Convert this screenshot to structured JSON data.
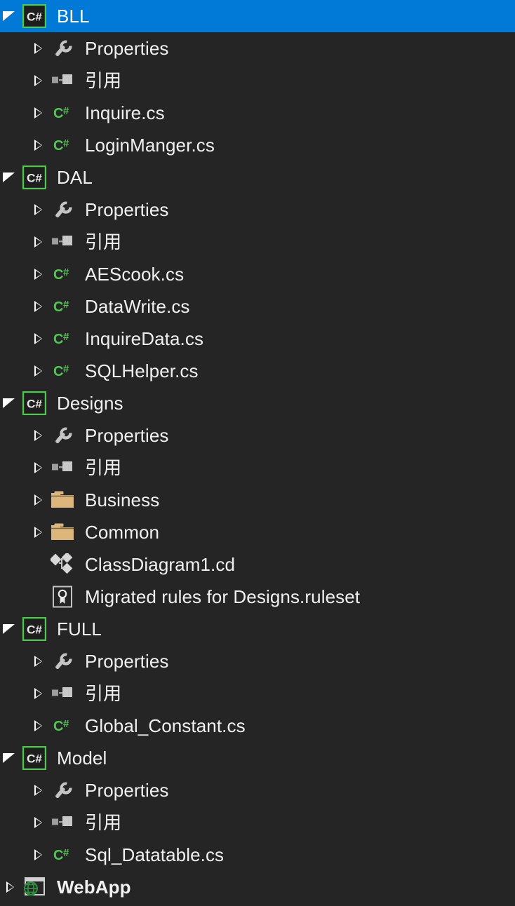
{
  "theme": {
    "background": "#252526",
    "selection": "#0179d7",
    "text": "#f0f0f0",
    "csharp_green": "#4ec94e",
    "folder_tan": "#dcb67a",
    "wrench_gray": "#c5c5c5",
    "reference_gray": "#b0b0b0",
    "globe_green": "#2e7d32"
  },
  "panel": {
    "name": "solution-explorer-tree"
  },
  "tree": {
    "rows": [
      {
        "label": "BLL",
        "icon": "csharp-project-icon",
        "indent": 0,
        "expander": "expanded",
        "selected": true,
        "bold": false
      },
      {
        "label": "Properties",
        "icon": "wrench-icon",
        "indent": 1,
        "expander": "collapsed",
        "selected": false,
        "bold": false
      },
      {
        "label": "引用",
        "icon": "references-icon",
        "indent": 1,
        "expander": "collapsed",
        "selected": false,
        "bold": false
      },
      {
        "label": "Inquire.cs",
        "icon": "csharp-file-icon",
        "indent": 1,
        "expander": "collapsed",
        "selected": false,
        "bold": false
      },
      {
        "label": "LoginManger.cs",
        "icon": "csharp-file-icon",
        "indent": 1,
        "expander": "collapsed",
        "selected": false,
        "bold": false
      },
      {
        "label": "DAL",
        "icon": "csharp-project-icon",
        "indent": 0,
        "expander": "expanded",
        "selected": false,
        "bold": false
      },
      {
        "label": "Properties",
        "icon": "wrench-icon",
        "indent": 1,
        "expander": "collapsed",
        "selected": false,
        "bold": false
      },
      {
        "label": "引用",
        "icon": "references-icon",
        "indent": 1,
        "expander": "collapsed",
        "selected": false,
        "bold": false
      },
      {
        "label": "AEScook.cs",
        "icon": "csharp-file-icon",
        "indent": 1,
        "expander": "collapsed",
        "selected": false,
        "bold": false
      },
      {
        "label": "DataWrite.cs",
        "icon": "csharp-file-icon",
        "indent": 1,
        "expander": "collapsed",
        "selected": false,
        "bold": false
      },
      {
        "label": "InquireData.cs",
        "icon": "csharp-file-icon",
        "indent": 1,
        "expander": "collapsed",
        "selected": false,
        "bold": false
      },
      {
        "label": "SQLHelper.cs",
        "icon": "csharp-file-icon",
        "indent": 1,
        "expander": "collapsed",
        "selected": false,
        "bold": false
      },
      {
        "label": "Designs",
        "icon": "csharp-project-icon",
        "indent": 0,
        "expander": "expanded",
        "selected": false,
        "bold": false
      },
      {
        "label": "Properties",
        "icon": "wrench-icon",
        "indent": 1,
        "expander": "collapsed",
        "selected": false,
        "bold": false
      },
      {
        "label": "引用",
        "icon": "references-icon",
        "indent": 1,
        "expander": "collapsed",
        "selected": false,
        "bold": false
      },
      {
        "label": "Business",
        "icon": "folder-icon",
        "indent": 1,
        "expander": "collapsed",
        "selected": false,
        "bold": false
      },
      {
        "label": "Common",
        "icon": "folder-icon",
        "indent": 1,
        "expander": "collapsed",
        "selected": false,
        "bold": false
      },
      {
        "label": "ClassDiagram1.cd",
        "icon": "class-diagram-icon",
        "indent": 1,
        "expander": "empty",
        "selected": false,
        "bold": false
      },
      {
        "label": "Migrated rules for Designs.ruleset",
        "icon": "ruleset-icon",
        "indent": 1,
        "expander": "empty",
        "selected": false,
        "bold": false
      },
      {
        "label": "FULL",
        "icon": "csharp-project-icon",
        "indent": 0,
        "expander": "expanded",
        "selected": false,
        "bold": false
      },
      {
        "label": "Properties",
        "icon": "wrench-icon",
        "indent": 1,
        "expander": "collapsed",
        "selected": false,
        "bold": false
      },
      {
        "label": "引用",
        "icon": "references-icon",
        "indent": 1,
        "expander": "collapsed",
        "selected": false,
        "bold": false
      },
      {
        "label": "Global_Constant.cs",
        "icon": "csharp-file-icon",
        "indent": 1,
        "expander": "collapsed",
        "selected": false,
        "bold": false
      },
      {
        "label": "Model",
        "icon": "csharp-project-icon",
        "indent": 0,
        "expander": "expanded",
        "selected": false,
        "bold": false
      },
      {
        "label": "Properties",
        "icon": "wrench-icon",
        "indent": 1,
        "expander": "collapsed",
        "selected": false,
        "bold": false
      },
      {
        "label": "引用",
        "icon": "references-icon",
        "indent": 1,
        "expander": "collapsed",
        "selected": false,
        "bold": false
      },
      {
        "label": "Sql_Datatable.cs",
        "icon": "csharp-file-icon",
        "indent": 1,
        "expander": "collapsed",
        "selected": false,
        "bold": false
      },
      {
        "label": "WebApp",
        "icon": "web-project-icon",
        "indent": 0,
        "expander": "collapsed",
        "selected": false,
        "bold": true
      }
    ]
  }
}
